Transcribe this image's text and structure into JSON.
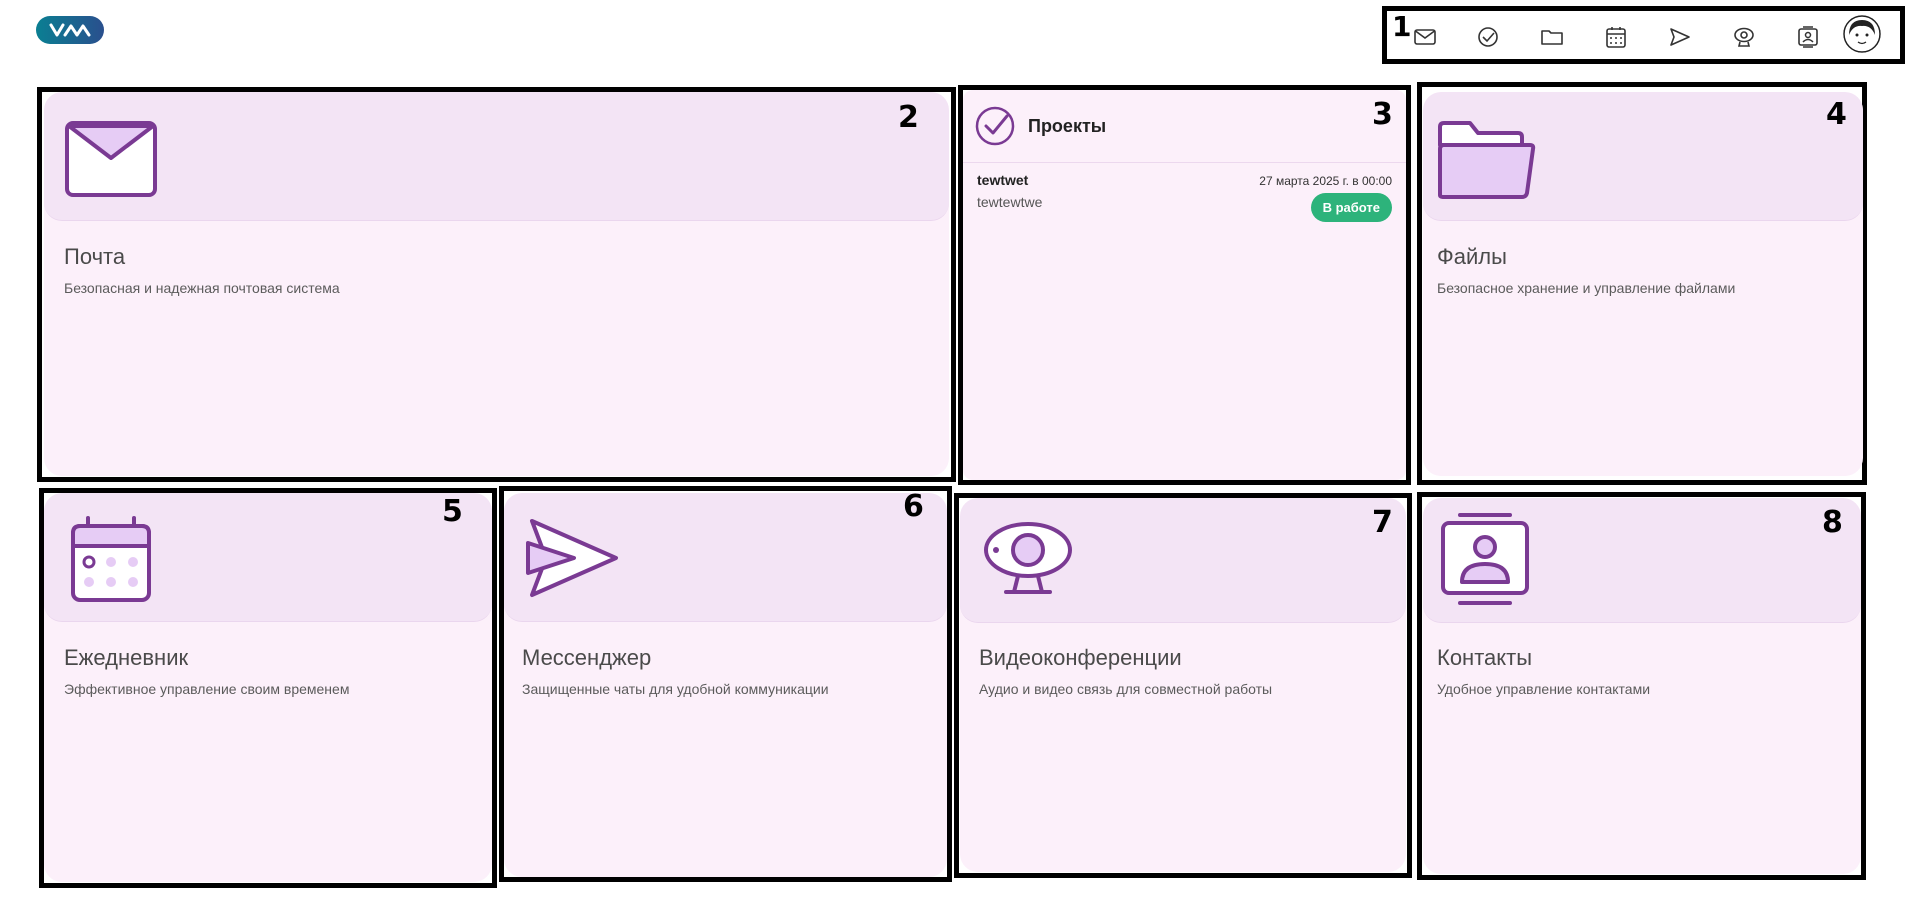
{
  "header": {
    "toolbar_marker": "1",
    "toolbar_icons": [
      "mail-icon",
      "check-circle-icon",
      "folder-icon",
      "calendar-icon",
      "send-icon",
      "webcam-icon",
      "contact-card-icon"
    ]
  },
  "cards": {
    "mail": {
      "marker": "2",
      "title": "Почта",
      "description": "Безопасная и надежная почтовая система"
    },
    "projects": {
      "marker": "3",
      "title": "Проекты",
      "item": {
        "name": "tewtwet",
        "subtitle": "tewtewtwe",
        "date": "27 марта 2025 г. в 00:00",
        "status": "В работе"
      }
    },
    "files": {
      "marker": "4",
      "title": "Файлы",
      "description": "Безопасное хранение и управление файлами"
    },
    "calendar": {
      "marker": "5",
      "title": "Ежедневник",
      "description": "Эффективное управление своим временем"
    },
    "messenger": {
      "marker": "6",
      "title": "Мессенджер",
      "description": "Защищенные чаты для удобной коммуникации"
    },
    "video": {
      "marker": "7",
      "title": "Видеоконференции",
      "description": "Аудио и видео связь для совместной работы"
    },
    "contacts": {
      "marker": "8",
      "title": "Контакты",
      "description": "Удобное управление контактами"
    }
  },
  "colors": {
    "card_bg": "#fcf0fa",
    "card_top": "#f3e4f5",
    "icon": "#7a3a93",
    "icon_fill": "#e6ccf5",
    "status": "#2db37b"
  }
}
